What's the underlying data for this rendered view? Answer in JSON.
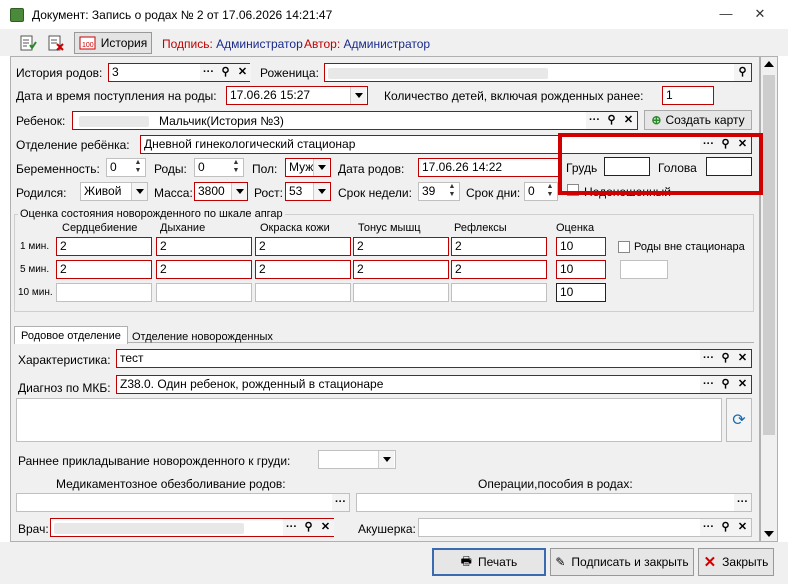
{
  "window": {
    "title": "Документ: Запись о родах № 2 от 17.06.2026 14:21:47",
    "min": "—",
    "close": "✕"
  },
  "toolbar": {
    "history_label": "История",
    "signed_key": "Подпись:",
    "signed_val": "Администратор",
    "author_key": "Автор:",
    "author_val": "Администратор"
  },
  "form": {
    "history_label": "История родов:",
    "history_value": "3",
    "mother_label": "Роженица:",
    "admit_label": "Дата и время поступления на роды:",
    "admit_value": "17.06.26 15:27",
    "children_label": "Количество детей, включая рожденных ранее:",
    "children_value": "1",
    "child_label": "Ребенок:",
    "child_value": "Мальчик(История №3)",
    "create_card": "Создать карту",
    "dept_label": "Отделение ребёнка:",
    "dept_value": "Дневной гинекологический стационар",
    "preg_label": "Беременность:",
    "preg_value": "0",
    "births_label": "Роды:",
    "births_value": "0",
    "sex_label": "Пол:",
    "sex_value": "Муж",
    "birthdate_label": "Дата родов:",
    "birthdate_value": "17.06.26 14:22",
    "chest_label": "Грудь",
    "head_label": "Голова",
    "born_label": "Родился:",
    "born_value": "Живой",
    "mass_label": "Масса:",
    "mass_value": "3800",
    "height_label": "Рост:",
    "height_value": "53",
    "weeks_label": "Срок недели:",
    "weeks_value": "39",
    "days_label": "Срок дни:",
    "days_value": "0",
    "premature_label": "Недоношенный"
  },
  "apgar": {
    "title": "Оценка состояния новорожденного по шкале апгар",
    "headers": [
      "Сердцебиение",
      "Дыхание",
      "Окраска кожи",
      "Тонус мышц",
      "Рефлексы",
      "Оценка"
    ],
    "rows": [
      {
        "label": "1 мин.",
        "values": [
          "2",
          "2",
          "2",
          "2",
          "2"
        ],
        "score": "10"
      },
      {
        "label": "5 мин.",
        "values": [
          "2",
          "2",
          "2",
          "2",
          "2"
        ],
        "score": "10"
      },
      {
        "label": "10 мин.",
        "values": [
          "",
          "",
          "",
          "",
          ""
        ],
        "score": "10"
      }
    ],
    "out_of_hospital": "Роды вне стационара"
  },
  "tabs": [
    {
      "label": "Родовое отделение"
    },
    {
      "label": "Отделение новорожденных"
    }
  ],
  "lower": {
    "char_label": "Характеристика:",
    "char_value": "тест",
    "mkb_label": "Диагноз по МКБ:",
    "mkb_value": "Z38.0. Один ребенок, рожденный в стационаре",
    "early_label": "Раннее прикладывание новорожденного к груди:",
    "anest_label": "Медикаментозное обезболивание родов:",
    "ops_label": "Операции,пособия в родах:",
    "doctor_label": "Врач:",
    "midwife_label": "Акушерка:"
  },
  "footer": {
    "print": "Печать",
    "sign_close": "Подписать и закрыть",
    "close": "Закрыть"
  },
  "colors": {
    "required_border": "#c00000",
    "highlight": "#d00000",
    "link": "#1a2a8a"
  }
}
